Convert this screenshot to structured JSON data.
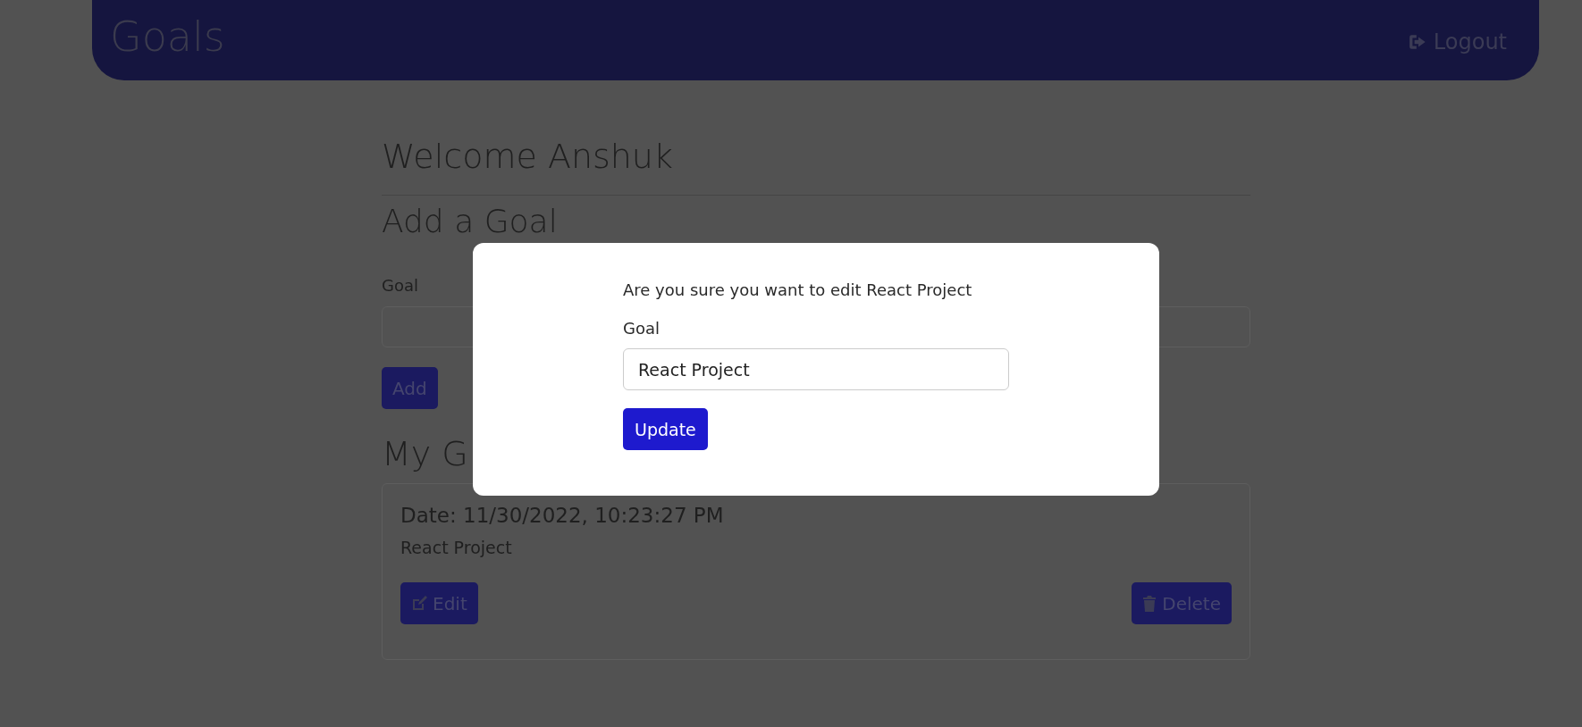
{
  "header": {
    "title": "Goals",
    "logout": "Logout"
  },
  "welcome": "Welcome Anshuk",
  "add_goal": {
    "heading": "Add a Goal",
    "label": "Goal",
    "button": "Add"
  },
  "my_goals": {
    "heading": "My G"
  },
  "goals": [
    {
      "date": "Date: 11/30/2022, 10:23:27 PM",
      "text": "React Project",
      "edit": "Edit",
      "delete": "Delete"
    }
  ],
  "modal": {
    "message": "Are you sure you want to edit React Project",
    "label": "Goal",
    "value": "React Project",
    "button": "Update"
  }
}
